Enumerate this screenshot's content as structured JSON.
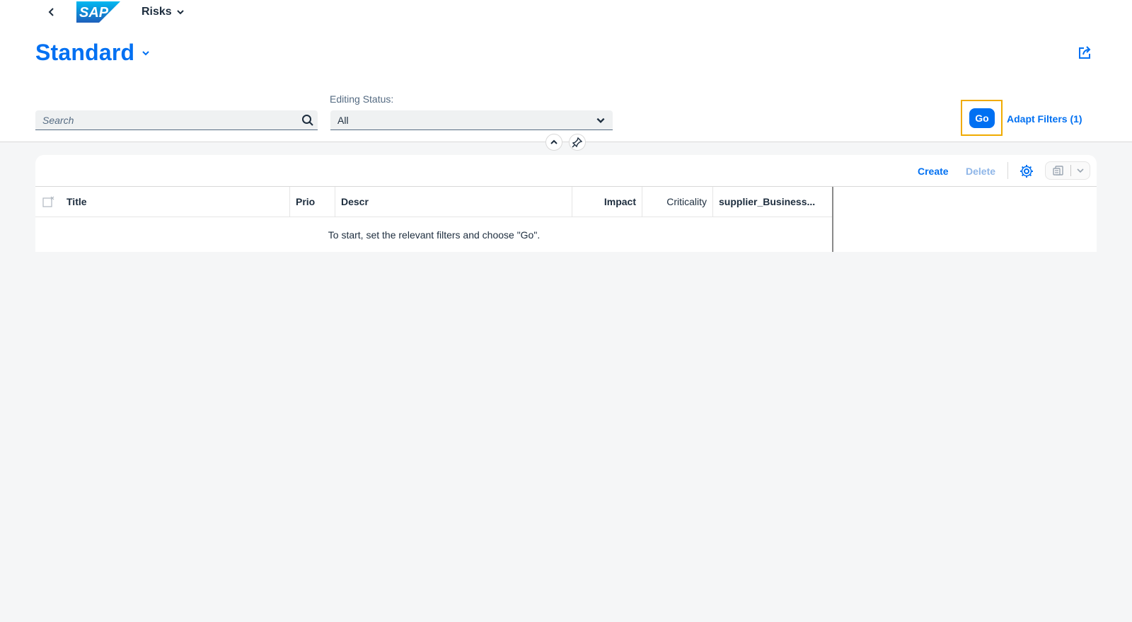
{
  "shell": {
    "logo_text": "SAP",
    "app_title": "Risks"
  },
  "header": {
    "variant_title": "Standard"
  },
  "filters": {
    "search_placeholder": "Search",
    "editing_status_label": "Editing Status:",
    "editing_status_value": "All",
    "go_label": "Go",
    "adapt_filters_label": "Adapt Filters (1)"
  },
  "toolbar": {
    "create_label": "Create",
    "delete_label": "Delete"
  },
  "table": {
    "columns": [
      "Title",
      "Prio",
      "Descr",
      "Impact",
      "Criticality",
      "supplier_Business..."
    ],
    "no_data_text": "To start, set the relevant filters and choose \"Go\"."
  },
  "colors": {
    "brand": "#0070f2",
    "highlight": "#f0ab00"
  }
}
